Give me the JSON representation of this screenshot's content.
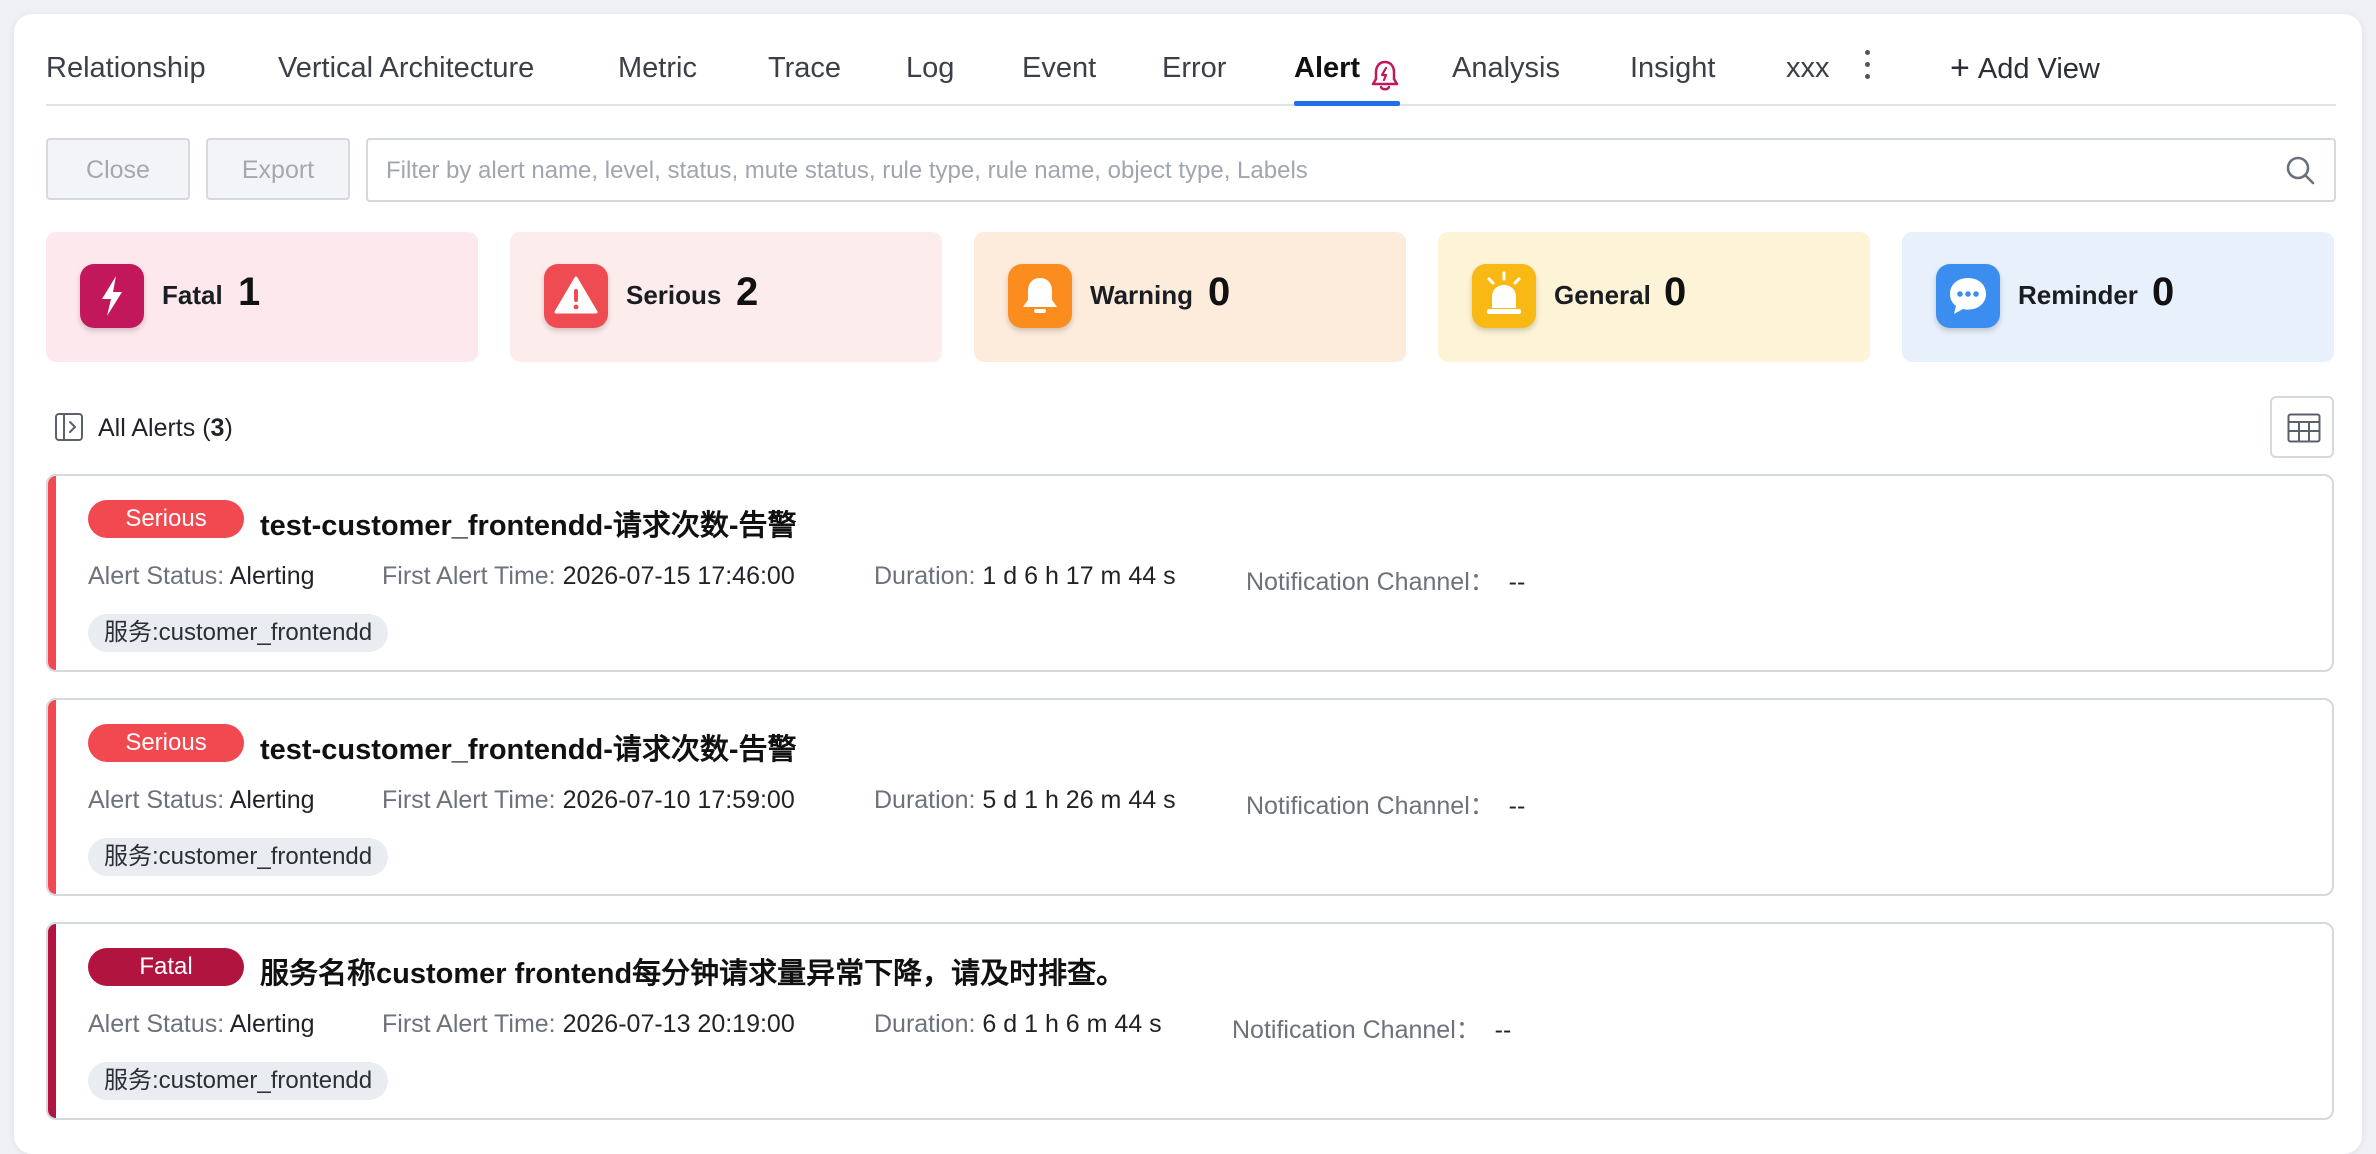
{
  "tabs": [
    {
      "label": "Relationship"
    },
    {
      "label": "Vertical Architecture"
    },
    {
      "label": "Metric"
    },
    {
      "label": "Trace"
    },
    {
      "label": "Log"
    },
    {
      "label": "Event"
    },
    {
      "label": "Error"
    },
    {
      "label": "Alert"
    },
    {
      "label": "Analysis"
    },
    {
      "label": "Insight"
    },
    {
      "label": "xxx"
    }
  ],
  "add_view_label": "Add View",
  "toolbar": {
    "close_label": "Close",
    "export_label": "Export",
    "search_placeholder": "Filter by alert name, level, status, mute status, rule type, rule name, object type, Labels"
  },
  "stats": [
    {
      "label": "Fatal",
      "count": "1",
      "bg": "#fde8ee",
      "icon_color": "#c2185b",
      "icon": "lightning-icon"
    },
    {
      "label": "Serious",
      "count": "2",
      "bg": "#fdecec",
      "icon_color": "#ef4b52",
      "icon": "warning-triangle-icon"
    },
    {
      "label": "Warning",
      "count": "0",
      "bg": "#fdebdc",
      "icon_color": "#fb8c1e",
      "icon": "bell-icon"
    },
    {
      "label": "General",
      "count": "0",
      "bg": "#fdf3d6",
      "icon_color": "#f9b914",
      "icon": "siren-icon"
    },
    {
      "label": "Reminder",
      "count": "0",
      "bg": "#e8f0fb",
      "icon_color": "#3b8ef0",
      "icon": "chat-bubble-icon"
    }
  ],
  "alerts_header": {
    "label": "All Alerts (",
    "count": "3",
    "suffix": ")"
  },
  "meta_labels": {
    "status": "Alert Status:",
    "first_time": "First Alert Time:",
    "duration": "Duration:",
    "channel": "Notification Channel："
  },
  "alerts": [
    {
      "level": "Serious",
      "level_color": "#f2484f",
      "title": "test-customer_frontendd-请求次数-告警",
      "status": "Alerting",
      "first_time": "2026-07-15 17:46:00",
      "duration": "1 d 6 h 17 m 44 s",
      "channel": "--",
      "tag": "服务:customer_frontendd"
    },
    {
      "level": "Serious",
      "level_color": "#f2484f",
      "title": "test-customer_frontendd-请求次数-告警",
      "status": "Alerting",
      "first_time": "2026-07-10 17:59:00",
      "duration": "5 d 1 h 26 m 44 s",
      "channel": "--",
      "tag": "服务:customer_frontendd"
    },
    {
      "level": "Fatal",
      "level_color": "#b0143f",
      "title": "服务名称customer frontend每分钟请求量异常下降，请及时排查。",
      "status": "Alerting",
      "first_time": "2026-07-13 20:19:00",
      "duration": "6 d 1 h 6 m 44 s",
      "channel": "--",
      "tag": "服务:customer_frontendd"
    }
  ],
  "colors": {
    "accent": "#1e6fe8"
  }
}
